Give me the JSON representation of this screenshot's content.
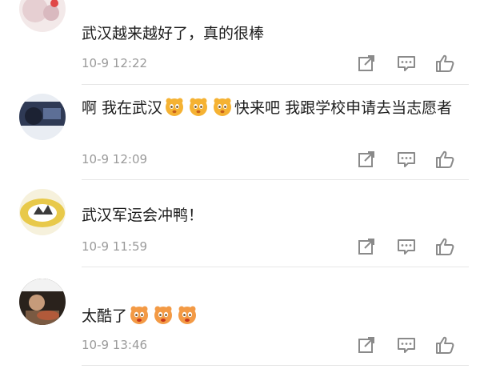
{
  "comments": [
    {
      "text_before": "武汉越来越好了，真的很棒",
      "emoji_count": 0,
      "text_after": "",
      "time": "10-9 12:22",
      "avatar_color": "#e9d8d8"
    },
    {
      "text_before": "啊 我在武汉",
      "emoji_count": 3,
      "text_after": "快来吧 我跟学校申请去当志愿者",
      "time": "10-9 12:09",
      "avatar_color": "#3d4a66"
    },
    {
      "text_before": "武汉军运会冲鸭！",
      "emoji_count": 0,
      "text_after": "",
      "time": "10-9 11:59",
      "avatar_color": "#e8c94a"
    },
    {
      "text_before": "太酷了",
      "emoji_count": 3,
      "text_after": "",
      "time": "10-9 13:46",
      "avatar_color": "#4a3b2f"
    }
  ],
  "icons": {
    "share": "share-icon",
    "reply": "comment-icon",
    "like": "thumbs-up-icon",
    "emoji": "emoji-face-icon"
  },
  "colors": {
    "text": "#1c1c1c",
    "time": "#9a9a9a",
    "icon": "#8a8a8a",
    "divider": "#e6e6e6",
    "emoji": "#f3a52e"
  }
}
